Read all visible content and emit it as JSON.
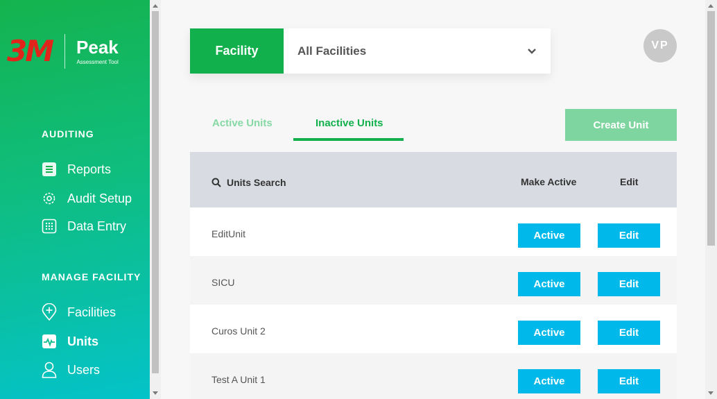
{
  "app": {
    "brand_mark": "3M",
    "product_name": "Peak",
    "tagline": "Assessment Tool"
  },
  "sidebar": {
    "sections": [
      {
        "title": "AUDITING",
        "items": [
          {
            "label": "Reports",
            "icon": "document-icon"
          },
          {
            "label": "Audit Setup",
            "icon": "gear-icon"
          },
          {
            "label": "Data Entry",
            "icon": "keypad-icon"
          }
        ]
      },
      {
        "title": "MANAGE FACILITY",
        "items": [
          {
            "label": "Facilities",
            "icon": "location-pin-icon"
          },
          {
            "label": "Units",
            "icon": "pulse-icon",
            "active": true
          },
          {
            "label": "Users",
            "icon": "user-icon"
          }
        ]
      }
    ]
  },
  "header": {
    "facility_label": "Facility",
    "facility_value": "All Facilities",
    "avatar_initials": "VP"
  },
  "tabs": [
    {
      "label": "Active Units",
      "active": false
    },
    {
      "label": "Inactive Units",
      "active": true
    }
  ],
  "create_button": "Create Unit",
  "table": {
    "search_label": "Units Search",
    "col_make_active": "Make Active",
    "col_edit": "Edit",
    "rows": [
      {
        "name": "EditUnit",
        "active_label": "Active",
        "edit_label": "Edit"
      },
      {
        "name": "SICU",
        "active_label": "Active",
        "edit_label": "Edit"
      },
      {
        "name": "Curos Unit 2",
        "active_label": "Active",
        "edit_label": "Edit"
      },
      {
        "name": "Test A Unit 1",
        "active_label": "Active",
        "edit_label": "Edit"
      }
    ]
  },
  "colors": {
    "brand_green": "#12b04c",
    "action_blue": "#00b9ea",
    "brand_red": "#e1251b"
  }
}
